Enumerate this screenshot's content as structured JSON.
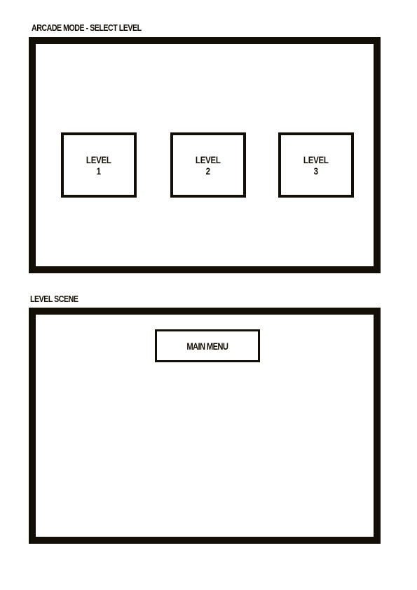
{
  "sections": {
    "select_level": {
      "label": "ARCADE MODE - SELECT LEVEL",
      "levels": [
        {
          "word": "LEVEL",
          "number": "1"
        },
        {
          "word": "LEVEL",
          "number": "2"
        },
        {
          "word": "LEVEL",
          "number": "3"
        }
      ]
    },
    "level_scene": {
      "label": "LEVEL SCENE",
      "main_menu_label": "MAIN MENU"
    }
  },
  "colors": {
    "ink": "#140f06",
    "background": "#ffffff"
  }
}
